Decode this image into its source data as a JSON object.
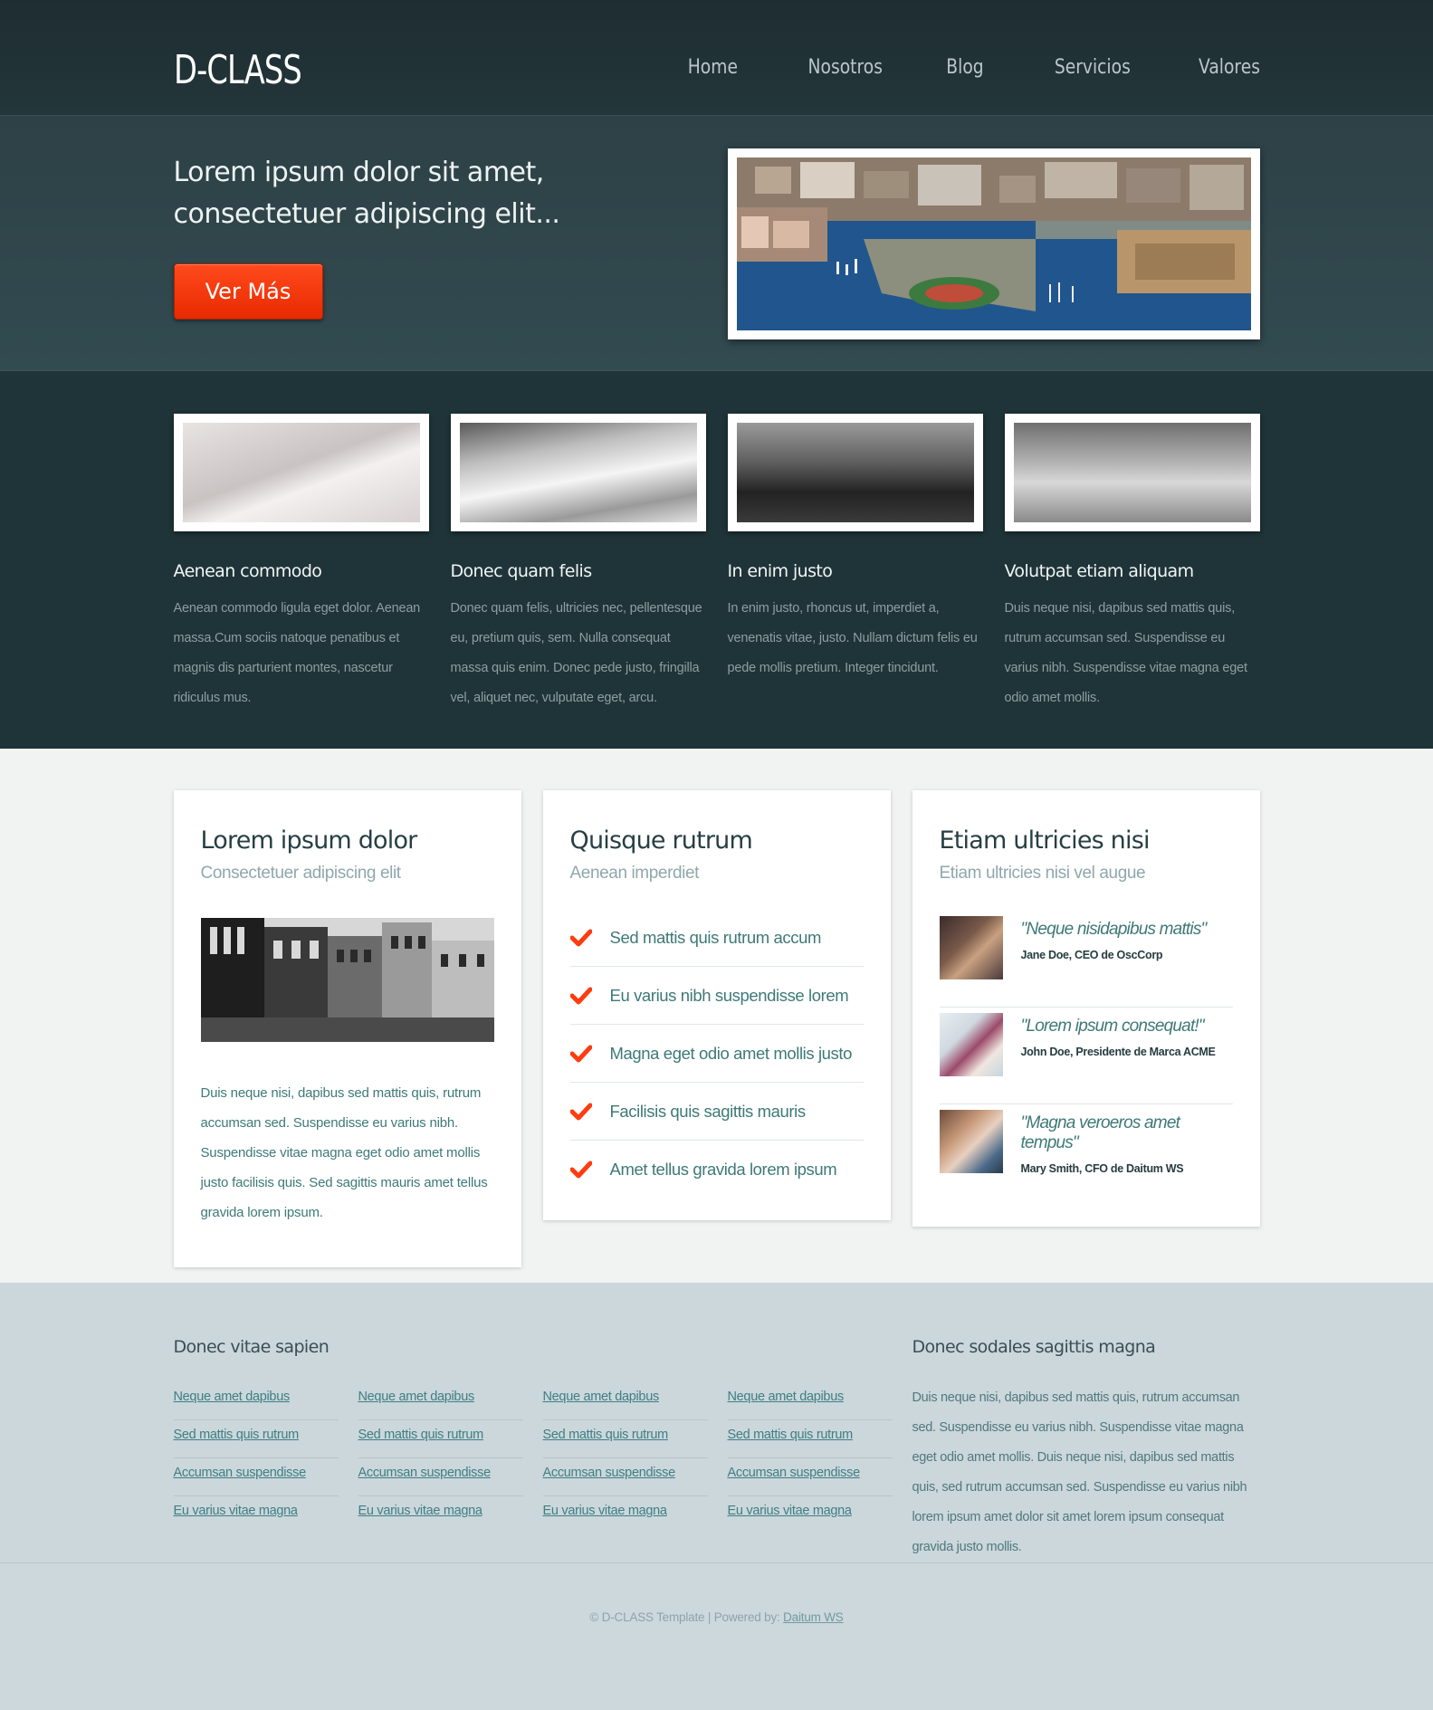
{
  "header": {
    "logo": "D-CLASS",
    "nav": [
      "Home",
      "Nosotros",
      "Blog",
      "Servicios",
      "Valores"
    ]
  },
  "hero": {
    "title": "Lorem ipsum dolor sit amet, consectetuer adipiscing elit...",
    "button": "Ver Más"
  },
  "features": [
    {
      "title": "Aenean commodo",
      "text": "Aenean commodo ligula eget dolor. Aenean massa.Cum sociis natoque penatibus et magnis dis parturient montes, nascetur ridiculus mus."
    },
    {
      "title": "Donec quam felis",
      "text": "Donec quam felis, ultricies nec, pellentesque eu, pretium quis, sem. Nulla consequat massa quis enim. Donec pede justo, fringilla vel, aliquet nec, vulputate eget, arcu."
    },
    {
      "title": "In enim justo",
      "text": "In enim justo, rhoncus ut, imperdiet a, venenatis vitae, justo. Nullam dictum felis eu pede mollis pretium. Integer tincidunt."
    },
    {
      "title": "Volutpat etiam aliquam",
      "text": "Duis neque nisi, dapibus sed mattis quis, rutrum accumsan sed. Suspendisse eu varius nibh. Suspendisse vitae magna eget odio amet mollis."
    }
  ],
  "cards": {
    "card1": {
      "title": "Lorem ipsum dolor",
      "subtitle": "Consectetuer adipiscing elit",
      "text": "Duis neque nisi, dapibus sed mattis quis, rutrum accumsan sed. Suspendisse eu varius nibh. Suspendisse vitae magna eget odio amet mollis justo facilisis quis. Sed sagittis mauris amet tellus gravida lorem ipsum."
    },
    "card2": {
      "title": "Quisque rutrum",
      "subtitle": "Aenean imperdiet",
      "items": [
        "Sed mattis quis rutrum accum",
        "Eu varius nibh suspendisse lorem",
        "Magna eget odio amet mollis justo",
        "Facilisis quis sagittis mauris",
        "Amet tellus gravida lorem ipsum"
      ]
    },
    "card3": {
      "title": "Etiam ultricies nisi",
      "subtitle": "Etiam ultricies nisi vel augue",
      "testimonials": [
        {
          "quote": "\"Neque nisidapibus mattis\"",
          "author": "Jane Doe, CEO de OscCorp"
        },
        {
          "quote": "\"Lorem ipsum consequat!\"",
          "author": "John Doe, Presidente de Marca ACME"
        },
        {
          "quote": "\"Magna veroeros amet tempus\"",
          "author": "Mary Smith, CFO de Daitum WS"
        }
      ]
    }
  },
  "footer": {
    "links_heading": "Donec vitae sapien",
    "link_columns": [
      [
        "Neque amet dapibus",
        "Sed mattis quis rutrum",
        "Accumsan suspendisse",
        "Eu varius vitae magna"
      ],
      [
        "Neque amet dapibus",
        "Sed mattis quis rutrum",
        "Accumsan suspendisse",
        "Eu varius vitae magna"
      ],
      [
        "Neque amet dapibus",
        "Sed mattis quis rutrum",
        "Accumsan suspendisse",
        "Eu varius vitae magna"
      ],
      [
        "Neque amet dapibus",
        "Sed mattis quis rutrum",
        "Accumsan suspendisse",
        "Eu varius vitae magna"
      ]
    ],
    "about_heading": "Donec sodales sagittis magna",
    "about_text": "Duis neque nisi, dapibus sed mattis quis, rutrum accumsan sed. Suspendisse eu varius nibh. Suspendisse vitae magna eget odio amet mollis. Duis neque nisi, dapibus sed mattis quis, sed rutrum accumsan sed. Suspendisse eu varius nibh lorem ipsum amet dolor sit amet lorem ipsum consequat gravida justo mollis."
  },
  "bottom": {
    "copyright": "© D-CLASS Template | Powered by:",
    "powered_link": "Daitum WS"
  },
  "colors": {
    "header_bg": "#1e2d31",
    "hero_bg": "#2d4146",
    "features_bg": "#1f3438",
    "accent": "#ff3c10",
    "teal_text": "#3e7978",
    "footer_bg": "#cbd7db"
  },
  "icons": {
    "checklist_icon": "check-icon"
  }
}
